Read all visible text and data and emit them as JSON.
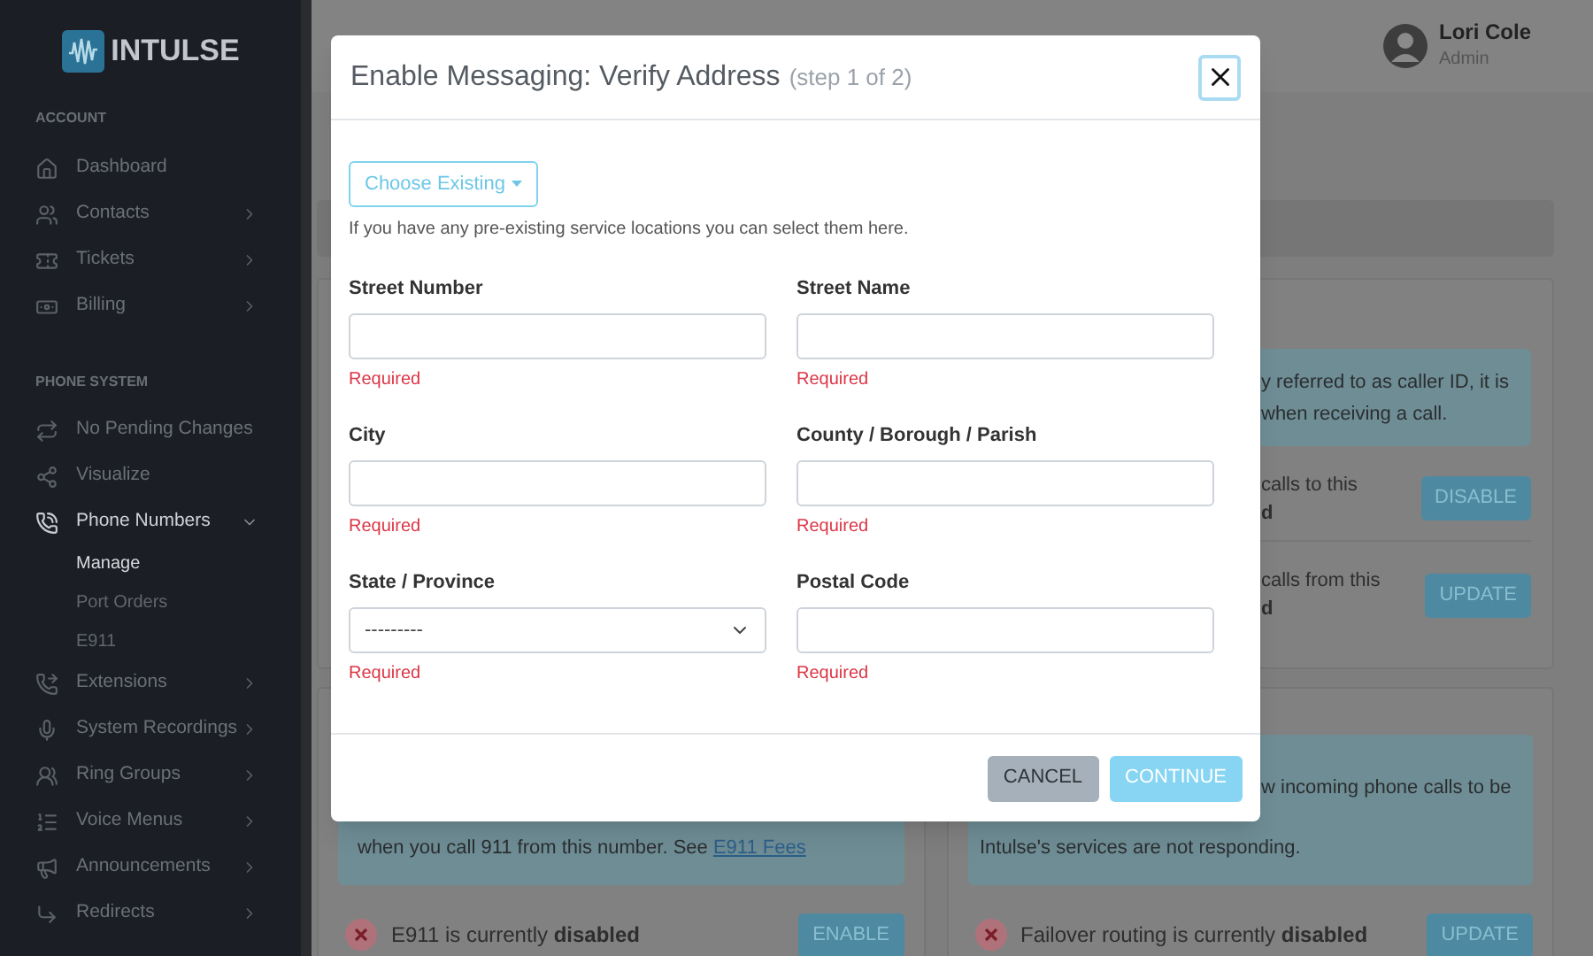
{
  "sidebar": {
    "logo": "INTULSE",
    "sections": [
      {
        "title": "ACCOUNT",
        "items": [
          {
            "label": "Dashboard",
            "expandable": false,
            "expanded": false
          },
          {
            "label": "Contacts",
            "expandable": true,
            "expanded": false
          },
          {
            "label": "Tickets",
            "expandable": true,
            "expanded": false
          },
          {
            "label": "Billing",
            "expandable": true,
            "expanded": false
          }
        ]
      },
      {
        "title": "PHONE SYSTEM",
        "items": [
          {
            "label": "No Pending Changes",
            "expandable": false,
            "expanded": false
          },
          {
            "label": "Visualize",
            "expandable": false,
            "expanded": false
          },
          {
            "label": "Phone Numbers",
            "expandable": true,
            "expanded": true,
            "children": [
              {
                "label": "Manage",
                "selected": true
              },
              {
                "label": "Port Orders",
                "selected": false
              },
              {
                "label": "E911",
                "selected": false
              }
            ]
          },
          {
            "label": "Extensions",
            "expandable": true,
            "expanded": false
          },
          {
            "label": "System Recordings",
            "expandable": true,
            "expanded": false
          },
          {
            "label": "Ring Groups",
            "expandable": true,
            "expanded": false
          },
          {
            "label": "Voice Menus",
            "expandable": true,
            "expanded": false
          },
          {
            "label": "Announcements",
            "expandable": true,
            "expanded": false
          },
          {
            "label": "Redirects",
            "expandable": true,
            "expanded": false
          }
        ]
      }
    ]
  },
  "header": {
    "user": {
      "name": "Lori Cole",
      "role": "Admin"
    }
  },
  "page": {
    "caller_id_card": {
      "info_lines": [
        "y referred to as caller ID, it is",
        "when receiving a call."
      ],
      "rows": [
        {
          "lines": [
            "calls to this",
            "d"
          ],
          "button": "DISABLE"
        },
        {
          "lines": [
            "calls from this",
            "d"
          ],
          "button": "UPDATE"
        }
      ]
    },
    "e911_card": {
      "info_line": "when you call 911 from this number. See ",
      "link": "E911 Fees",
      "status": "E911 is currently **disabled**",
      "button": "ENABLE"
    },
    "failover_card": {
      "info_lines": [
        "w incoming phone calls to be",
        "Intulse's services are not responding."
      ],
      "status": "Failover routing is currently **disabled**",
      "button": "UPDATE"
    }
  },
  "modal": {
    "title": "Enable Messaging: Verify Address",
    "step": "(step 1 of 2)",
    "choose_button": "Choose Existing",
    "help": "If you have any pre-existing service locations you can select them here.",
    "fields": [
      {
        "label": "Street Number",
        "kind": "text",
        "error": "Required"
      },
      {
        "label": "Street Name",
        "kind": "text",
        "error": "Required"
      },
      {
        "label": "City",
        "kind": "text",
        "error": "Required"
      },
      {
        "label": "County / Borough / Parish",
        "kind": "text",
        "error": "Required"
      },
      {
        "label": "State / Province",
        "kind": "select",
        "value": "---------",
        "error": "Required"
      },
      {
        "label": "Postal Code",
        "kind": "text",
        "error": "Required"
      }
    ],
    "buttons": [
      {
        "label": "CANCEL",
        "kind": "secondary"
      },
      {
        "label": "CONTINUE",
        "kind": "primary"
      }
    ]
  }
}
